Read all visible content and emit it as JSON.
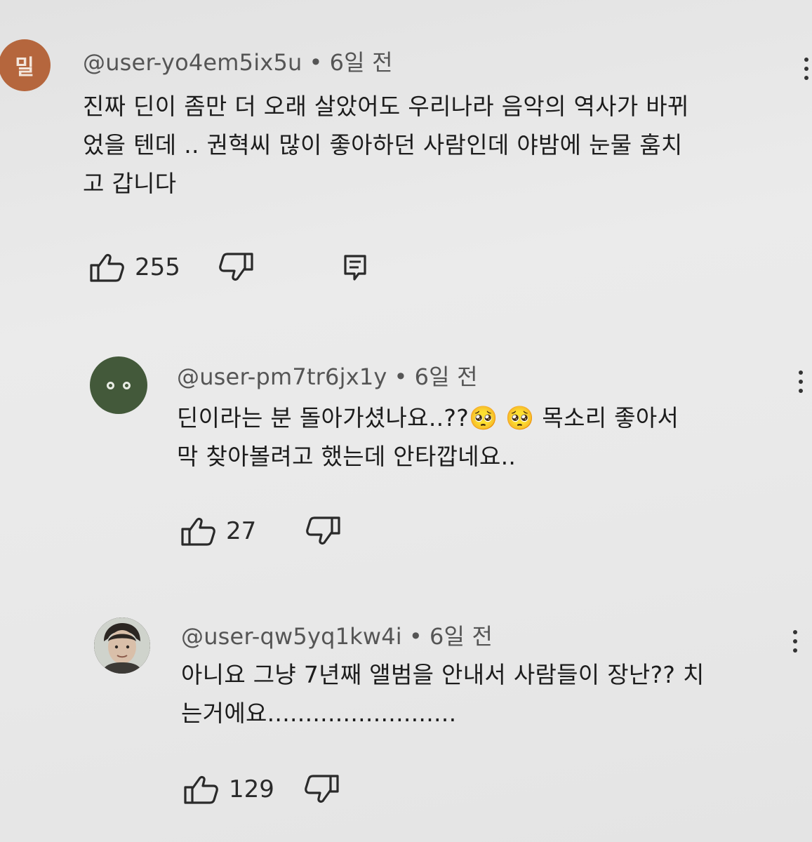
{
  "comments": [
    {
      "avatar_text": "밀",
      "username": "@user-yo4em5ix5u",
      "separator": "•",
      "time": "6일 전",
      "lines": [
        "진짜 딘이 좀만 더 오래 살았어도 우리나라 음악의 역사가 바뀌",
        "었을 텐데 .. 권혁씨 많이 좋아하던 사람인데 야밤에 눈물 훔치",
        "고 갑니다"
      ],
      "likes": "255",
      "icons": {
        "like": "thumbs-up-icon",
        "dislike": "thumbs-down-icon",
        "reply": "reply-icon",
        "more": "more-vertical-icon"
      }
    },
    {
      "username": "@user-pm7tr6jx1y",
      "separator": "•",
      "time": "6일 전",
      "lines": [
        "딘이라는 분 돌아가셨나요..??🥺 🥺  목소리 좋아서",
        "막 찾아볼려고 했는데 안타깝네요.."
      ],
      "likes": "27",
      "icons": {
        "like": "thumbs-up-icon",
        "dislike": "thumbs-down-icon",
        "more": "more-vertical-icon"
      }
    },
    {
      "username": "@user-qw5yq1kw4i",
      "separator": "•",
      "time": "6일 전",
      "lines": [
        "아니요 그냥 7년째 앨범을 안내서 사람들이 장난?? 치",
        "는거에요........................."
      ],
      "likes": "129",
      "icons": {
        "like": "thumbs-up-icon",
        "dislike": "thumbs-down-icon",
        "more": "more-vertical-icon"
      }
    }
  ],
  "colors": {
    "background": "#e8e8e8",
    "avatar1": "#b5663d",
    "avatar2": "#43593a",
    "text": "#1c1c1c",
    "meta": "#555555"
  }
}
